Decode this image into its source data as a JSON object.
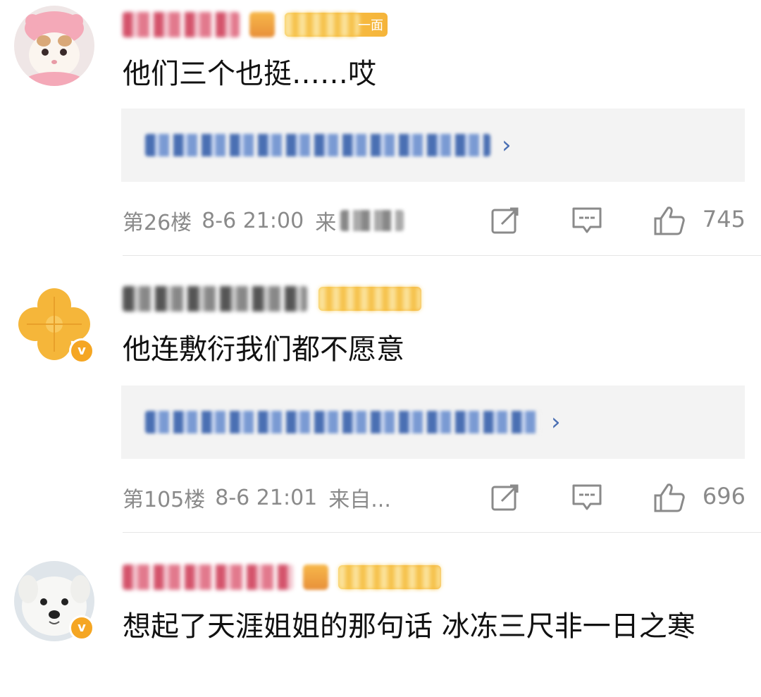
{
  "comments": [
    {
      "content": "他们三个也挺……哎",
      "member_tag": "一面",
      "floor": "第26楼",
      "time": "8-6 21:00",
      "source_prefix": "来",
      "likes": "745",
      "has_verified_badge": false,
      "avatar": "cat-avatar"
    },
    {
      "content": "他连敷衍我们都不愿意",
      "member_tag": "",
      "floor": "第105楼",
      "time": "8-6 21:01",
      "source_prefix": "来自...",
      "likes": "696",
      "has_verified_badge": true,
      "verified_badge_text": "v",
      "avatar": "clover-avatar"
    },
    {
      "content": "想起了天涯姐姐的那句话  冰冻三尺非一日之寒",
      "member_tag": "",
      "has_verified_badge": true,
      "verified_badge_text": "v",
      "avatar": "dog-avatar"
    }
  ],
  "colors": {
    "background": "#ffffff",
    "reply_box": "#f3f3f3",
    "reply_link": "#4a6fb3",
    "meta_text": "#8a8a8a",
    "badge": "#f5a623"
  }
}
